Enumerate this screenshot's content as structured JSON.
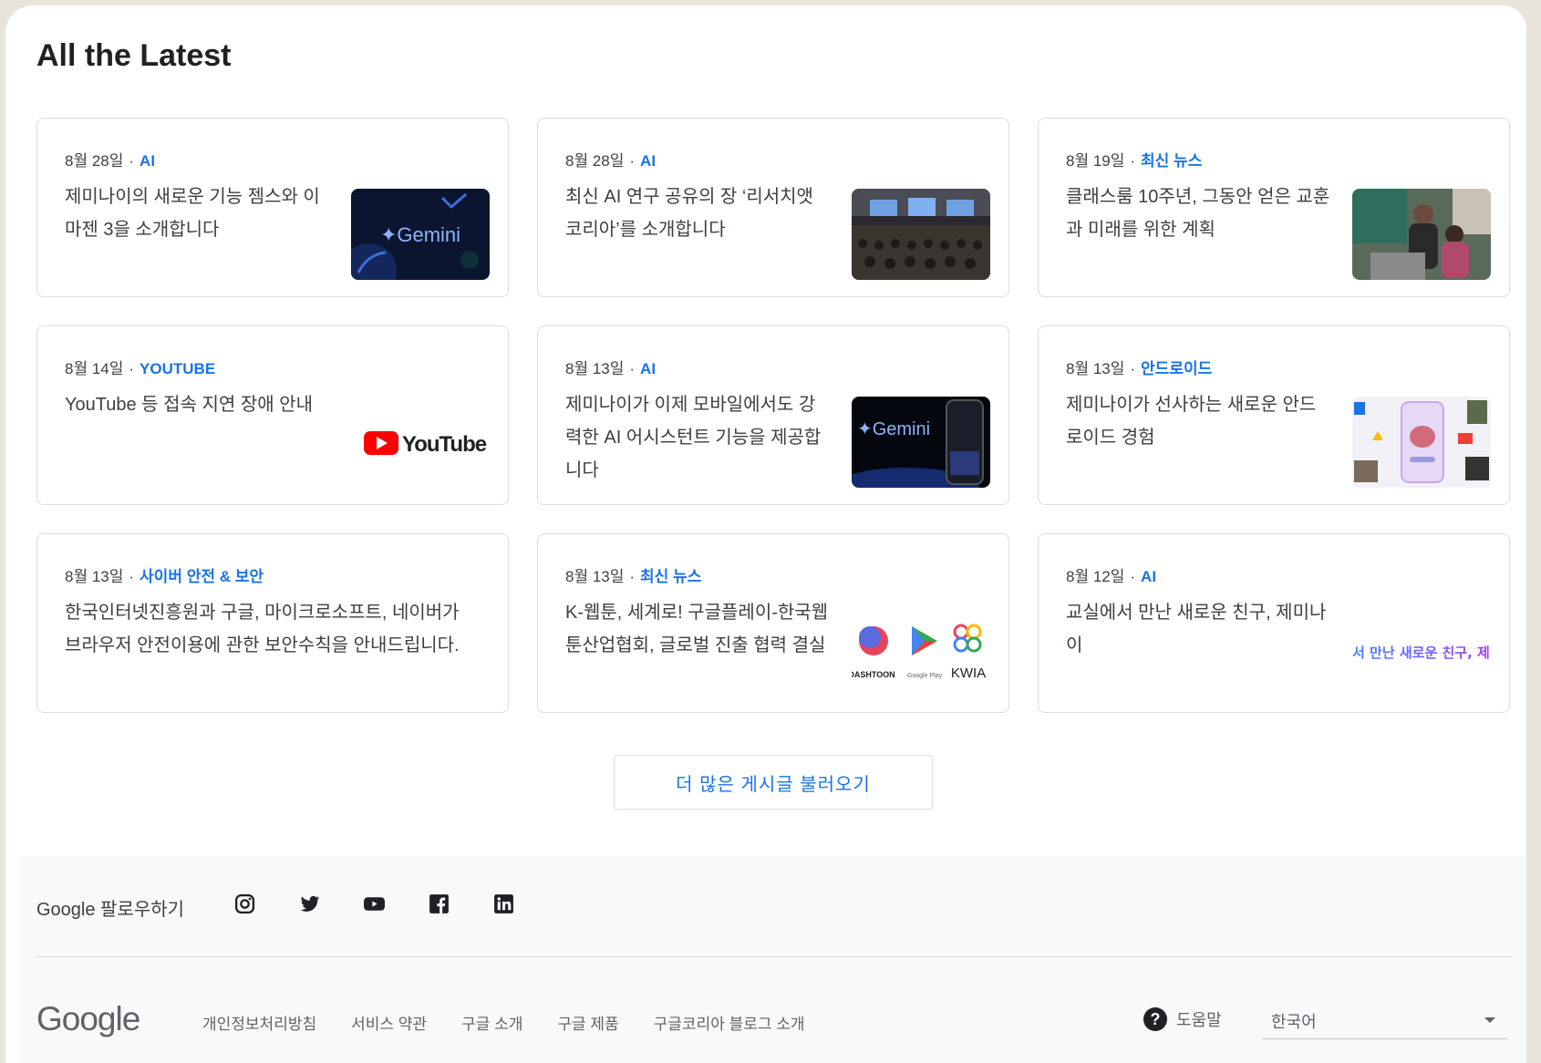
{
  "section": {
    "title": "All the Latest"
  },
  "separator": "·",
  "articles": [
    {
      "date": "8월 28일",
      "category": "AI",
      "headline": "제미나이의 새로운 기능 젬스와 이마젠 3을 소개합니다",
      "thumb_text": "✦Gemini",
      "thumb_icon": "gemini-logo-icon"
    },
    {
      "date": "8월 28일",
      "category": "AI",
      "headline": "최신 AI 연구 공유의 장 ‘리서치앳 코리아’를 소개합니다",
      "thumb_icon": "conference-photo-icon"
    },
    {
      "date": "8월 19일",
      "category": "최신 뉴스",
      "headline": "클래스룸 10주년, 그동안 얻은 교훈과 미래를 위한 계획",
      "thumb_icon": "classroom-photo-icon"
    },
    {
      "date": "8월 14일",
      "category": "YOUTUBE",
      "headline": "YouTube 등 접속 지연 장애 안내",
      "thumb_text": "YouTube",
      "thumb_icon": "youtube-logo-icon"
    },
    {
      "date": "8월 13일",
      "category": "AI",
      "headline": "제미나이가 이제 모바일에서도 강력한 AI 어시스턴트 기능을 제공합니다",
      "thumb_text": "✦Gemini",
      "thumb_icon": "gemini-phone-icon"
    },
    {
      "date": "8월 13일",
      "category": "안드로이드",
      "headline": "제미나이가 선사하는 새로운 안드로이드 경험",
      "thumb_icon": "android-collage-icon"
    },
    {
      "date": "8월 13일",
      "category": "사이버 안전 & 보안",
      "headline": "한국인터넷진흥원과 구글, 마이크로소프트, 네이버가 브라우저 안전이용에 관한 보안수칙을 안내드립니다."
    },
    {
      "date": "8월 13일",
      "category": "최신 뉴스",
      "headline": "K-웹툰, 세계로! 구글플레이-한국웹툰산업협회, 글로벌 진출 협력 결실",
      "thumb_labels": [
        "DASHTOON",
        "Google Play",
        "KWIA"
      ],
      "thumb_icon": "webtoon-logos-icon"
    },
    {
      "date": "8월 12일",
      "category": "AI",
      "headline": "교실에서 만난 새로운 친구, 제미나이",
      "thumb_text": "서 만난 새로운 친구, 제",
      "thumb_icon": "gemini-classroom-text-icon"
    }
  ],
  "load_more": {
    "label": "더 많은 게시글 불러오기"
  },
  "footer": {
    "follow_label": "Google 팔로우하기",
    "social": [
      "instagram-icon",
      "twitter-icon",
      "youtube-icon",
      "facebook-icon",
      "linkedin-icon"
    ],
    "logo": "Google",
    "links": [
      "개인정보처리방침",
      "서비스 약관",
      "구글 소개",
      "구글 제품",
      "구글코리아 블로그 소개"
    ],
    "help_label": "도움말",
    "language": "한국어"
  },
  "colors": {
    "accent": "#1a73e8",
    "text": "#3c4043",
    "border": "#dadce0",
    "footer_bg": "#f8f9fa"
  }
}
